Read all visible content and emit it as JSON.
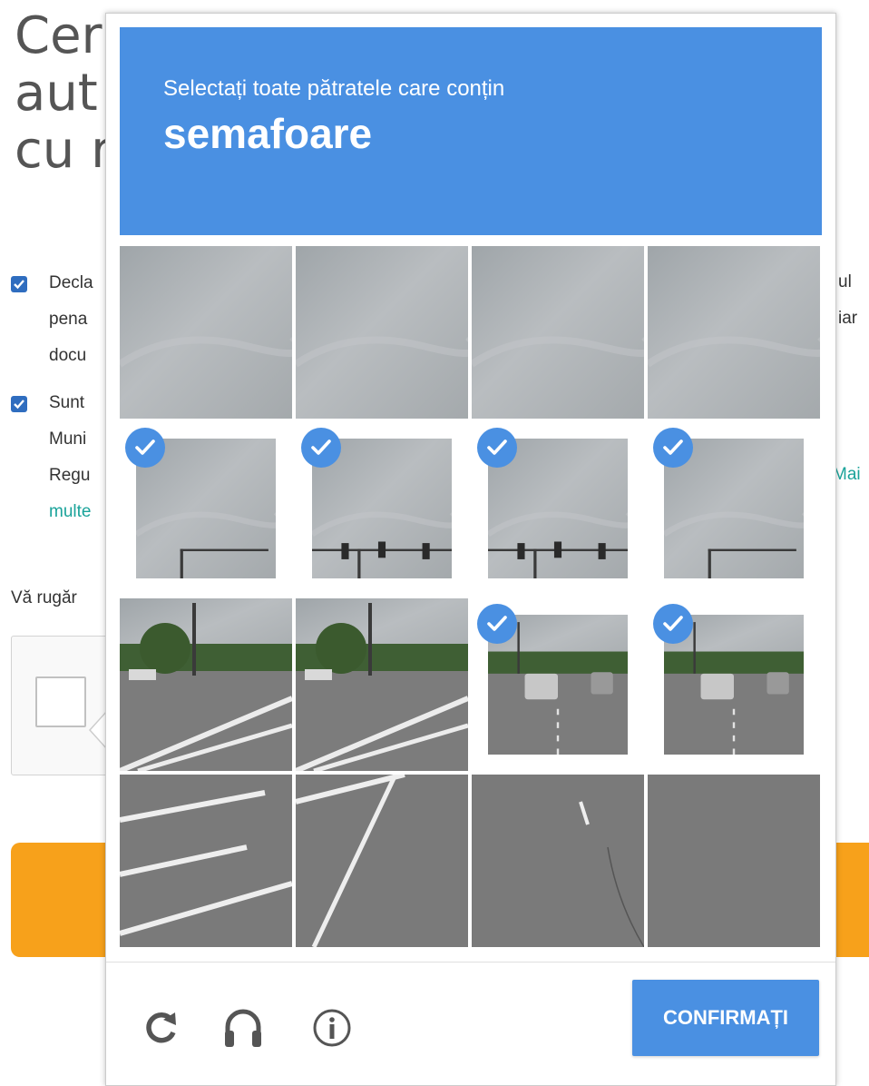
{
  "background": {
    "title_lines": [
      "Cer",
      "aut",
      "cu r"
    ],
    "checkbox1": {
      "lines": [
        "Decla",
        "pena",
        "docu"
      ],
      "right_lines": [
        "ul",
        "iar"
      ]
    },
    "checkbox2": {
      "lines": [
        "Sunt",
        "Muni",
        "Regu"
      ],
      "link": "multe",
      "right_link": "Mai"
    },
    "please_text": "Vă rugăr",
    "colors": {
      "checkbox": "#2f6dbf",
      "link": "#1aa39a",
      "orange_button": "#f7a11b"
    }
  },
  "challenge": {
    "instruction": "Selectați toate pătratele care conțin",
    "target": "semafoare",
    "header_color": "#4a90e2",
    "grid_rows": 4,
    "grid_cols": 4,
    "selected_tiles": [
      4,
      5,
      6,
      7,
      10,
      11
    ],
    "tile_scenes": [
      "sky",
      "sky",
      "sky",
      "sky",
      "sky-pole",
      "sky-lights",
      "sky-lights",
      "sky-pole",
      "road-trees",
      "road-trees",
      "road-cars",
      "road-cars",
      "road",
      "road",
      "road",
      "road"
    ],
    "footer": {
      "reload_icon": "reload-icon",
      "audio_icon": "headphones-icon",
      "info_icon": "info-icon",
      "confirm_label": "CONFIRMAȚI"
    }
  }
}
